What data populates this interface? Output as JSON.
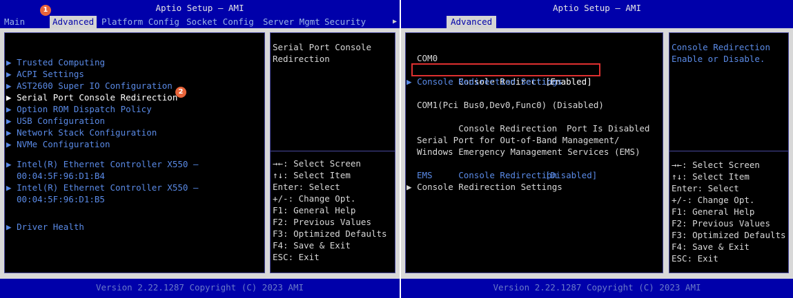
{
  "left": {
    "title": "Aptio Setup – AMI",
    "tabs": [
      "Main",
      "Advanced",
      "Platform Config",
      "Socket Config",
      "Server Mgmt",
      "Security"
    ],
    "more_tabs_arrow": "▶",
    "badge1": "1",
    "badge2": "2",
    "menu": [
      "Trusted Computing",
      "ACPI Settings",
      "AST2600 Super IO Configuration",
      "Serial Port Console Redirection",
      "Option ROM Dispatch Policy",
      "USB Configuration",
      "Network Stack Configuration",
      "NVMe Configuration",
      "Intel(R) Ethernet Controller X550 –",
      "00:04:5F:96:D1:B4",
      "Intel(R) Ethernet Controller X550 –",
      "00:04:5F:96:D1:B5",
      "Driver Health"
    ],
    "help_top": [
      "Serial Port Console",
      "Redirection"
    ],
    "footer": "Version 2.22.1287 Copyright (C) 2023 AMI"
  },
  "right": {
    "title": "Aptio Setup – AMI",
    "tab": "Advanced",
    "lines": {
      "com0": "COM0",
      "cr_label": "Console Redirection",
      "cr_value": "[Enabled]",
      "crs": "Console Redirection Settings",
      "com1": "COM1(Pci Bus0,Dev0,Func0) (Disabled)",
      "cr2_label": "Console Redirection",
      "cr2_value": "Port Is Disabled",
      "ems1": "Serial Port for Out-of-Band Management/",
      "ems2": "Windows Emergency Management Services (EMS)",
      "cr3_label": "Console Redirection",
      "cr3_value": "[Disabled]",
      "ems": "EMS",
      "crs2": "Console Redirection Settings"
    },
    "help_top": [
      "Console Redirection",
      "Enable or Disable."
    ],
    "footer": "Version 2.22.1287 Copyright (C) 2023 AMI"
  },
  "keys": [
    "→←: Select Screen",
    "↑↓: Select Item",
    "Enter: Select",
    "+/-: Change Opt.",
    "F1: General Help",
    "F2: Previous Values",
    "F3: Optimized Defaults",
    "F4: Save & Exit",
    "ESC: Exit"
  ],
  "colors": {
    "bios_blue": "#0000aa",
    "highlight_text": "#5a8ae6",
    "badge": "#e8643a",
    "select_box": "#e03030"
  }
}
